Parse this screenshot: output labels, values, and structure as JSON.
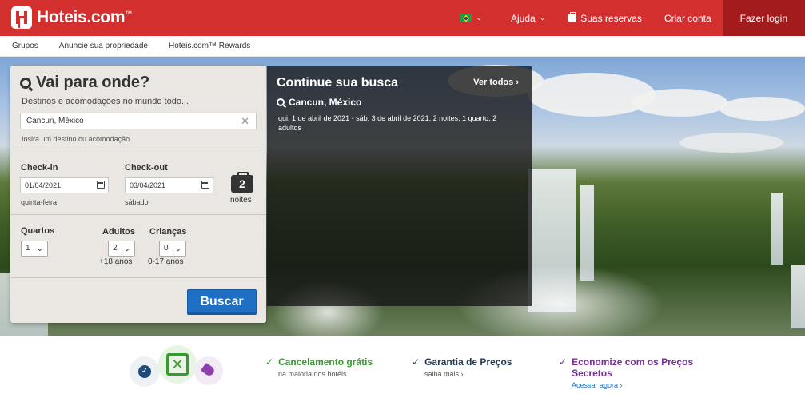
{
  "header": {
    "brand": "Hoteis.com",
    "brand_tm": "™",
    "help": "Ajuda",
    "reservations": "Suas reservas",
    "create_account": "Criar conta",
    "login": "Fazer login",
    "flag_country": "Brasil"
  },
  "subnav": [
    "Grupos",
    "Anuncie sua propriedade",
    "Hoteis.com™ Rewards"
  ],
  "search": {
    "title": "Vai para onde?",
    "subtitle": "Destinos e acomodações no mundo todo...",
    "destination_value": "Cancun, México",
    "destination_hint": "Insira um destino ou acomodação",
    "checkin_label": "Check-in",
    "checkin_value": "01/04/2021",
    "checkin_day": "quinta-feira",
    "checkout_label": "Check-out",
    "checkout_value": "03/04/2021",
    "checkout_day": "sábado",
    "nights_count": "2",
    "nights_label": "noites",
    "rooms_label": "Quartos",
    "rooms_value": "1",
    "adults_label": "Adultos",
    "adults_value": "2",
    "adults_age": "+18 anos",
    "children_label": "Crianças",
    "children_value": "0",
    "children_age": "0-17 anos",
    "submit": "Buscar"
  },
  "continue": {
    "title": "Continue sua busca",
    "see_all": "Ver todos",
    "destination": "Cancun, México",
    "details": "qui, 1 de abril de 2021 - sáb, 3 de abril de 2021, 2 noites, 1 quarto, 2 adultos"
  },
  "benefits": [
    {
      "title": "Cancelamento grátis",
      "subtitle": "na maioria dos hotéis",
      "color": "#3a9a32"
    },
    {
      "title": "Garantia de Preços",
      "subtitle": "saiba mais",
      "color": "#1f3a55"
    },
    {
      "title": "Economize com os Preços Secretos",
      "subtitle": "Acessar agora",
      "color": "#7b2c9e"
    }
  ],
  "colors": {
    "brand_red": "#d32f2f",
    "button_blue": "#1f6fc5"
  }
}
